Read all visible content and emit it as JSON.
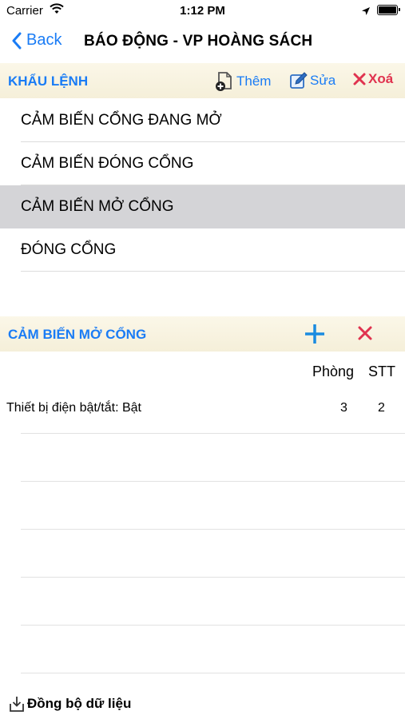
{
  "status_bar": {
    "carrier": "Carrier",
    "time": "1:12 PM"
  },
  "nav": {
    "back_label": "Back",
    "title": "BÁO ĐỘNG - VP HOÀNG SÁCH"
  },
  "commands_section": {
    "title": "KHẨU LỆNH",
    "add_label": "Thêm",
    "edit_label": "Sửa",
    "delete_label": "Xoá"
  },
  "commands": [
    {
      "label": "CẢM BIẾN CỔNG ĐANG MỞ",
      "selected": false
    },
    {
      "label": "CẢM BIẾN ĐÓNG CỔNG",
      "selected": false
    },
    {
      "label": "CẢM BIẾN MỞ CỔNG",
      "selected": true
    },
    {
      "label": "ĐÓNG CỔNG",
      "selected": false
    }
  ],
  "detail_section": {
    "title": "CẢM BIẾN MỞ CỔNG"
  },
  "columns": {
    "room": "Phòng",
    "order": "STT"
  },
  "devices": [
    {
      "name": "Thiết bị điện bật/tắt: Bật",
      "room": "3",
      "order": "2"
    }
  ],
  "footer": {
    "sync_label": "Đồng bộ dữ liệu"
  },
  "colors": {
    "accent": "#1a7cf5",
    "danger": "#e0334f",
    "header_bg": "#f8f3e0",
    "selected_row": "#d4d4d7"
  }
}
